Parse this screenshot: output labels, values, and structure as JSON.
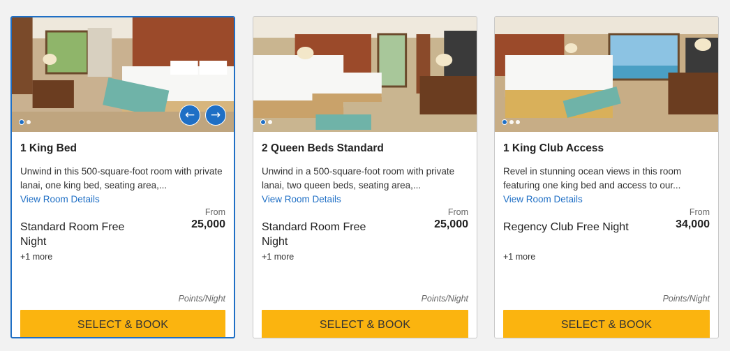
{
  "cards": [
    {
      "title": "1 King Bed",
      "description": "Unwind in this 500-square-foot room with private lanai, one king bed, seating area,...",
      "details_link": "View Room Details",
      "rate_name": "Standard Room Free Night",
      "from_label": "From",
      "points": "25,000",
      "more": "+1 more",
      "points_unit": "Points/Night",
      "button": "SELECT & BOOK",
      "selected": true,
      "dots": 2,
      "prev_icon": "←",
      "next_icon": "→"
    },
    {
      "title": "2 Queen Beds Standard",
      "description": "Unwind in a 500-square-foot room with private lanai, two queen beds, seating area,...",
      "details_link": "View Room Details",
      "rate_name": "Standard Room Free Night",
      "from_label": "From",
      "points": "25,000",
      "more": "+1 more",
      "points_unit": "Points/Night",
      "button": "SELECT & BOOK",
      "selected": false,
      "dots": 2
    },
    {
      "title": "1 King Club Access",
      "description": "Revel in stunning ocean views in this room featuring one king bed and access to our...",
      "details_link": "View Room Details",
      "rate_name": "Regency Club Free Night",
      "from_label": "From",
      "points": "34,000",
      "more": "+1 more",
      "points_unit": "Points/Night",
      "button": "SELECT & BOOK",
      "selected": false,
      "dots": 3
    }
  ],
  "colors": {
    "accent": "#1f6fc5",
    "button": "#fbb40f"
  }
}
